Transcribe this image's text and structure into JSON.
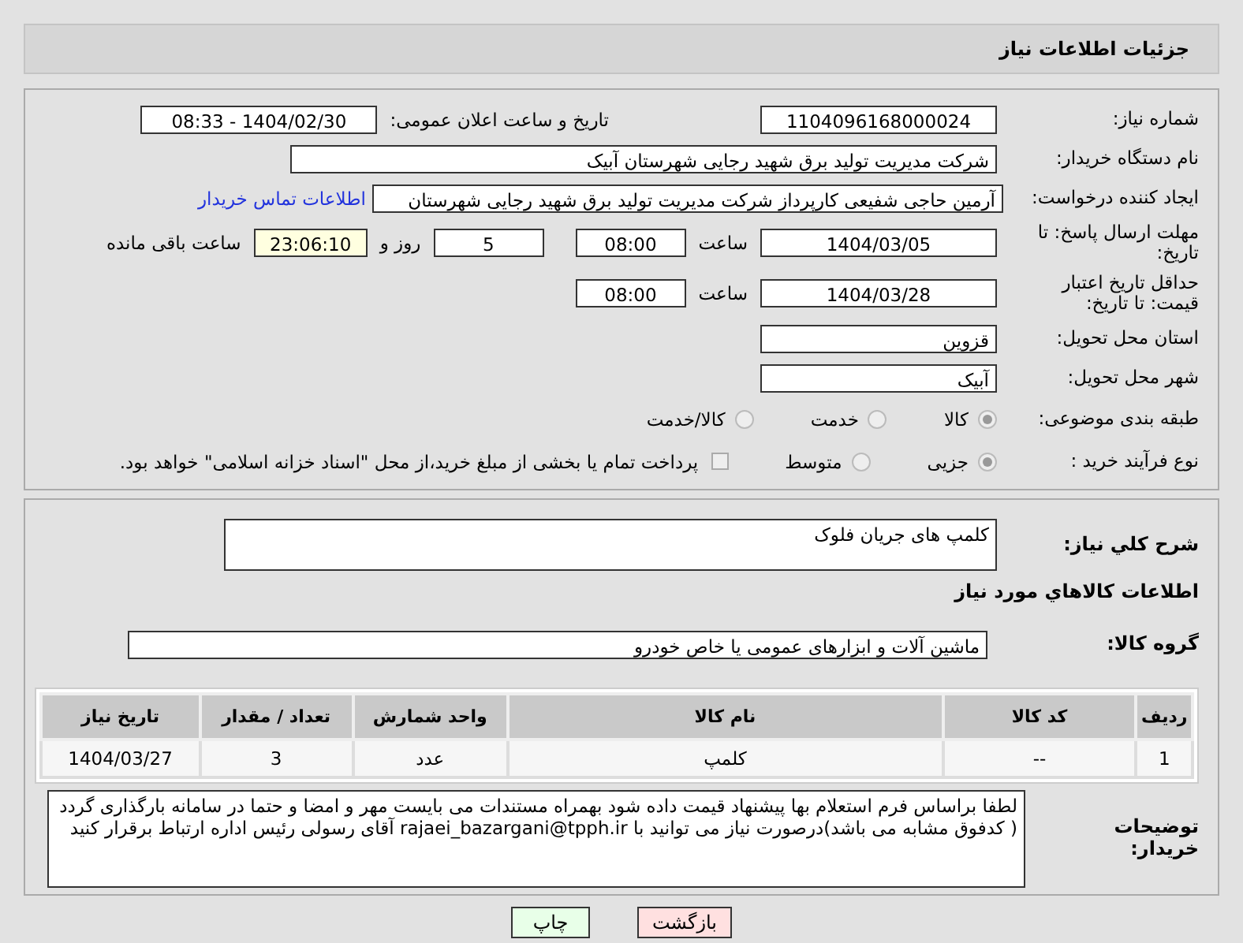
{
  "header": {
    "title": "جزئیات اطلاعات نیاز"
  },
  "need_number": {
    "label": "شماره نیاز:",
    "value": "1104096168000024"
  },
  "announce": {
    "label": "تاریخ و ساعت اعلان عمومی:",
    "value": "1404/02/30 - 08:33"
  },
  "buyer": {
    "label": "نام دستگاه خریدار:",
    "value": "شرکت مدیریت تولید برق شهید رجایی شهرستان آبیک"
  },
  "requester": {
    "label": "ایجاد کننده درخواست:",
    "value": "آرمین حاجی شفیعی کارپرداز شرکت مدیریت تولید برق شهید رجایی شهرستان",
    "link": "اطلاعات تماس خریدار"
  },
  "deadline": {
    "label": "مهلت ارسال پاسخ: تا تاریخ:",
    "date": "1404/03/05",
    "time_label": "ساعت",
    "time": "08:00",
    "days": "5",
    "days_label": "روز و",
    "remaining": "23:06:10",
    "remaining_label": "ساعت باقی مانده"
  },
  "price_validity": {
    "label": "حداقل تاریخ اعتبار قیمت: تا تاریخ:",
    "date": "1404/03/28",
    "time_label": "ساعت",
    "time": "08:00"
  },
  "province": {
    "label": "استان محل تحویل:",
    "value": "قزوین"
  },
  "city": {
    "label": "شهر محل تحویل:",
    "value": "آبیک"
  },
  "category": {
    "label": "طبقه بندی موضوعی:",
    "options": [
      {
        "label": "کالا",
        "selected": true
      },
      {
        "label": "خدمت",
        "selected": false
      },
      {
        "label": "کالا/خدمت",
        "selected": false
      }
    ]
  },
  "process": {
    "label": "نوع فرآیند خرید :",
    "options": [
      {
        "label": "جزیی",
        "selected": true
      },
      {
        "label": "متوسط",
        "selected": false
      }
    ],
    "treasury": {
      "checked": false,
      "label": "پرداخت تمام یا بخشی از مبلغ خرید،از محل \"اسناد خزانه اسلامی\" خواهد بود."
    }
  },
  "description": {
    "label": "شرح کلي نياز:",
    "value": "کلمپ های جریان فلوک"
  },
  "goods_heading": "اطلاعات کالاهاي مورد نياز",
  "goods_group": {
    "label": "گروه کالا:",
    "value": "ماشین آلات و ابزارهای عمومی یا خاص خودرو"
  },
  "table": {
    "columns": [
      "ردیف",
      "کد کالا",
      "نام کالا",
      "واحد شمارش",
      "تعداد / مقدار",
      "تاریخ نیاز"
    ],
    "rows": [
      [
        "1",
        "--",
        "کلمپ",
        "عدد",
        "3",
        "1404/03/27"
      ]
    ]
  },
  "buyer_notes": {
    "label": "توضیحات خریدار:",
    "value": "لطفا براساس فرم استعلام بها پیشنهاد قیمت داده شود بهمراه مستندات می بایست مهر و امضا و حتما در سامانه بارگذاری گردد ( کدفوق مشابه می باشد)درصورت نیاز می توانید با rajaei_bazargani@tpph.ir آقای رسولی رئیس  اداره ارتباط برقرار کنید"
  },
  "buttons": [
    {
      "label": "بازگشت",
      "kind": "back"
    },
    {
      "label": "چاپ",
      "kind": "print"
    }
  ]
}
